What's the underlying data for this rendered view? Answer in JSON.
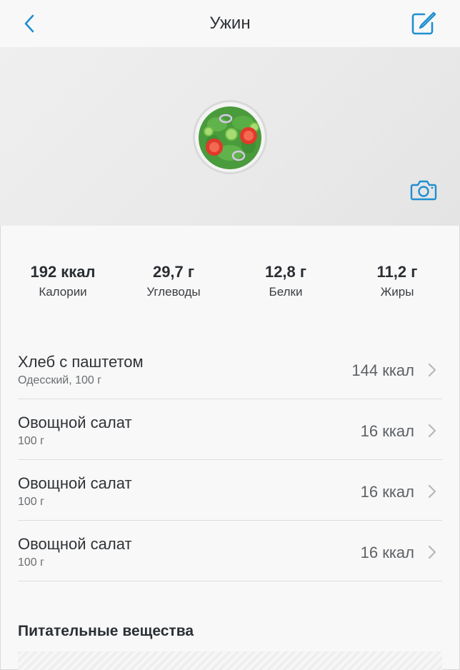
{
  "header": {
    "title": "Ужин",
    "back_icon": "chevron-left-icon",
    "edit_icon": "edit-note-icon",
    "accent_color": "#1f8fd1"
  },
  "hero": {
    "image": "salad-bowl-icon",
    "camera_icon": "camera-icon"
  },
  "summary": [
    {
      "value": "192 ккал",
      "label": "Калории"
    },
    {
      "value": "29,7 г",
      "label": "Углеводы"
    },
    {
      "value": "12,8 г",
      "label": "Белки"
    },
    {
      "value": "11,2 г",
      "label": "Жиры"
    }
  ],
  "items": [
    {
      "name": "Хлеб с паштетом",
      "detail": "Одесский, 100 г",
      "kcal": "144 ккал"
    },
    {
      "name": "Овощной салат",
      "detail": "100 г",
      "kcal": "16 ккал"
    },
    {
      "name": "Овощной салат",
      "detail": "100 г",
      "kcal": "16 ккал"
    },
    {
      "name": "Овощной салат",
      "detail": "100 г",
      "kcal": "16 ккал"
    }
  ],
  "nutrients": {
    "title": "Питательные вещества"
  }
}
